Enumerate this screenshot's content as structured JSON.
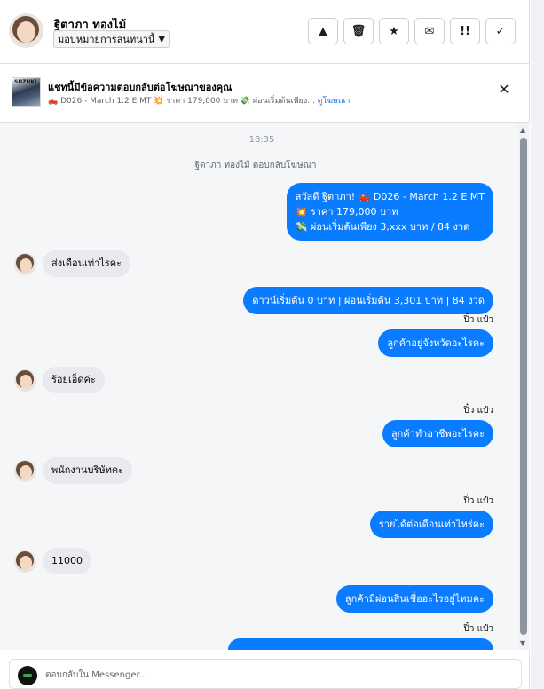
{
  "header": {
    "name": "ฐิตาภา ทองไม้",
    "assign_label": "มอบหมายการสนทนานี้",
    "actions": [
      {
        "icon": "warning-icon",
        "glyph": "▲"
      },
      {
        "icon": "trash-icon",
        "glyph": "🗑"
      },
      {
        "icon": "star-icon",
        "glyph": "★"
      },
      {
        "icon": "mail-icon",
        "glyph": "✉"
      },
      {
        "icon": "alert-icon",
        "glyph": "!!"
      },
      {
        "icon": "check-icon",
        "glyph": "✓"
      }
    ]
  },
  "ad_banner": {
    "thumb_tag": "SUZUKI",
    "title": "แชทนี้มีข้อความตอบกลับต่อโฆษณาของคุณ",
    "subtitle": "🛻 D026 - March 1.2 E MT 💥 ราคา 179,000 บาท 💸 ผ่อนเริ่มต้นเพียง...",
    "view_ad": "ดูโฆษณา",
    "close_glyph": "✕"
  },
  "chat": {
    "time": "18:35",
    "reply_note": "ฐิตาภา ทองไม้ ตอบกลับโฆษณา",
    "messages": [
      {
        "dir": "out",
        "lines": [
          "สวัสดี ฐิตาภา! 🛻 D026 - March 1.2 E MT",
          "💥 ราคา 179,000 บาท",
          "💸 ผ่อนเริ่มต้นเพียง 3,xxx บาท / 84 งวด"
        ]
      },
      {
        "dir": "in",
        "text": "ส่งเดือนเท่าไรคะ"
      },
      {
        "dir": "out",
        "text": "ดาวน์เริ่มต้น 0 บาท | ผ่อนเริ่มต้น 3,301 บาท | 84 งวด"
      },
      {
        "dir": "sender",
        "text": "ปิ๋ว แป๋ว"
      },
      {
        "dir": "out",
        "text": "ลูกค้าอยู่จังหวัดอะไรคะ"
      },
      {
        "dir": "in",
        "text": "ร้อยเอ็ดค่ะ"
      },
      {
        "dir": "sender",
        "text": "ปิ๋ว แป๋ว"
      },
      {
        "dir": "out",
        "text": "ลูกค้าทำอาชีพอะไรคะ"
      },
      {
        "dir": "in",
        "text": "พนักงานบริษัทคะ"
      },
      {
        "dir": "sender",
        "text": "ปิ๋ว แป๋ว"
      },
      {
        "dir": "out",
        "text": "รายได้ต่อเดือนเท่าไหร่คะ"
      },
      {
        "dir": "in",
        "text": "11000"
      },
      {
        "dir": "out",
        "text": "ลูกค้ามีผ่อนสินเชื่ออะไรอยู่ไหมคะ"
      },
      {
        "dir": "sender",
        "text": "ปิ๋ว แป๋ว"
      }
    ]
  },
  "composer": {
    "placeholder": "ตอบกลับใน Messenger..."
  }
}
